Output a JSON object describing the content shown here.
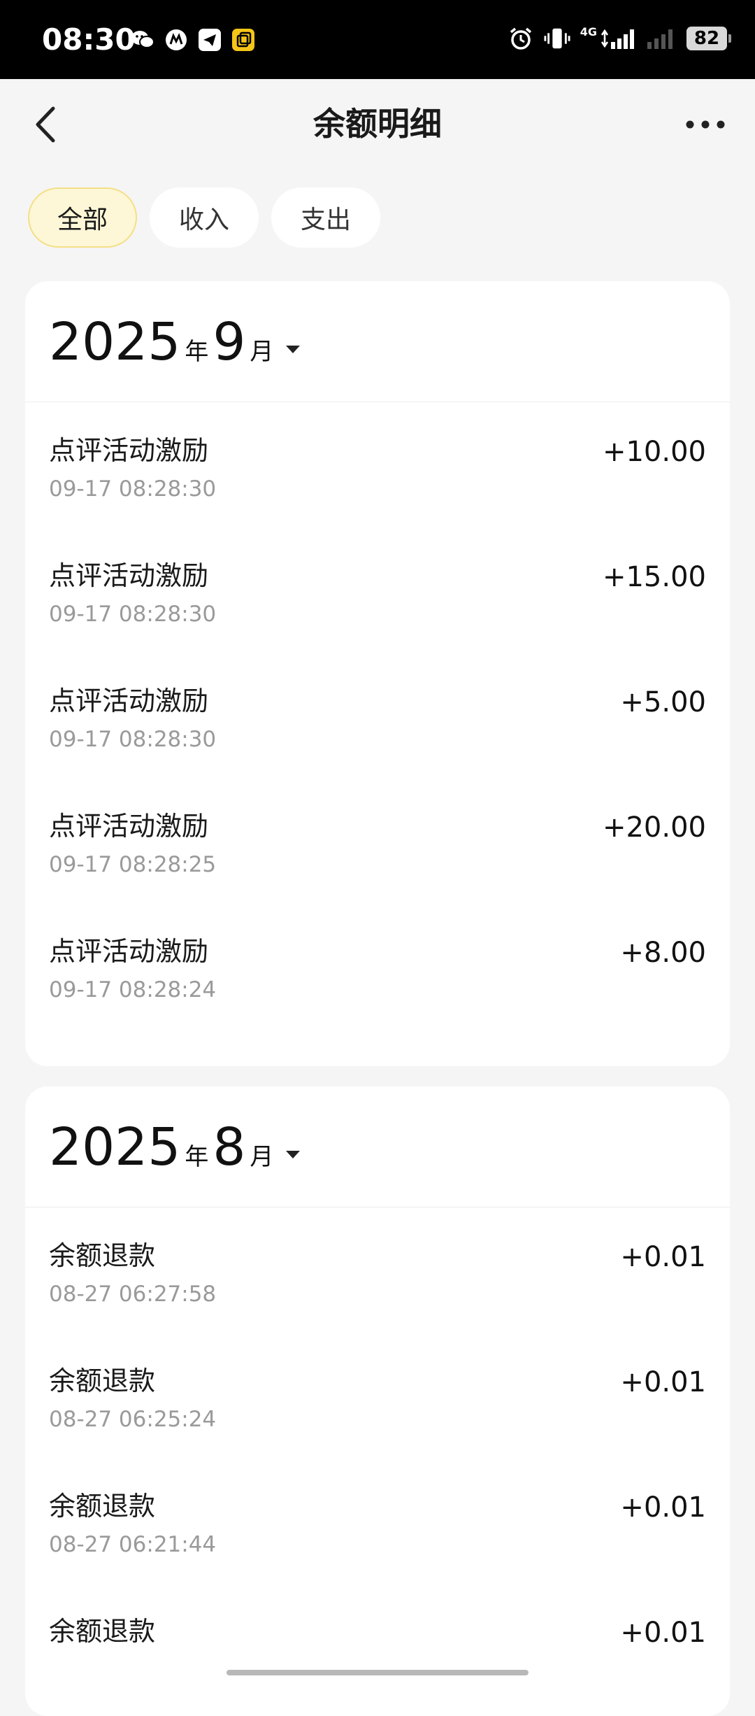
{
  "status_bar": {
    "time": "08:30",
    "network": "4G",
    "battery": "82",
    "icons_left": [
      "wechat-icon",
      "app-logo-icon",
      "telegram-icon",
      "clipboard-icon"
    ],
    "icons_right": [
      "alarm-icon",
      "vibrate-icon",
      "signal-icon",
      "signal-weak-icon",
      "battery-icon"
    ]
  },
  "nav": {
    "title": "余额明细"
  },
  "filters": [
    {
      "label": "全部",
      "active": true
    },
    {
      "label": "收入",
      "active": false
    },
    {
      "label": "支出",
      "active": false
    }
  ],
  "months": [
    {
      "year": "2025",
      "year_unit": "年",
      "month": "9",
      "month_unit": "月",
      "transactions": [
        {
          "title": "点评活动激励",
          "time": "09-17 08:28:30",
          "amount": "+10.00"
        },
        {
          "title": "点评活动激励",
          "time": "09-17 08:28:30",
          "amount": "+15.00"
        },
        {
          "title": "点评活动激励",
          "time": "09-17 08:28:30",
          "amount": "+5.00"
        },
        {
          "title": "点评活动激励",
          "time": "09-17 08:28:25",
          "amount": "+20.00"
        },
        {
          "title": "点评活动激励",
          "time": "09-17 08:28:24",
          "amount": "+8.00"
        }
      ]
    },
    {
      "year": "2025",
      "year_unit": "年",
      "month": "8",
      "month_unit": "月",
      "transactions": [
        {
          "title": "余额退款",
          "time": "08-27 06:27:58",
          "amount": "+0.01"
        },
        {
          "title": "余额退款",
          "time": "08-27 06:25:24",
          "amount": "+0.01"
        },
        {
          "title": "余额退款",
          "time": "08-27 06:21:44",
          "amount": "+0.01"
        },
        {
          "title": "余额退款",
          "time": "",
          "amount": "+0.01"
        }
      ]
    }
  ],
  "colors": {
    "accent_chip_bg": "#fdf7d7",
    "accent_chip_border": "#f4df86",
    "page_bg": "#f5f5f5",
    "secondary_text": "#9a9a9a"
  }
}
